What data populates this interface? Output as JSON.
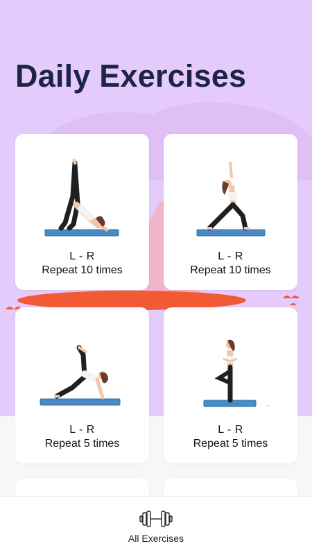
{
  "header": {
    "title": "Daily Exercises"
  },
  "exercises": [
    {
      "side": "L - R",
      "repeat": "Repeat 10 times",
      "pose": "three-legged-downward-dog"
    },
    {
      "side": "L - R",
      "repeat": "Repeat 10 times",
      "pose": "warrior-one"
    },
    {
      "side": "L - R",
      "repeat": "Repeat 5 times",
      "pose": "side-plank-leg-raise"
    },
    {
      "side": "L - R",
      "repeat": "Repeat 5 times",
      "pose": "tree-pose"
    }
  ],
  "bottom_nav": {
    "label": "All Exercises",
    "icon": "dumbbell-icon"
  },
  "colors": {
    "hero_bg": "#e5cbfb",
    "title": "#1d2448",
    "mat": "#4a8bc4",
    "mat_stroke": "#2f6fa8",
    "skin": "#f1c7a8",
    "pants": "#1f1f24",
    "hair": "#6b3a2a",
    "accent_orange": "#f2623a"
  }
}
